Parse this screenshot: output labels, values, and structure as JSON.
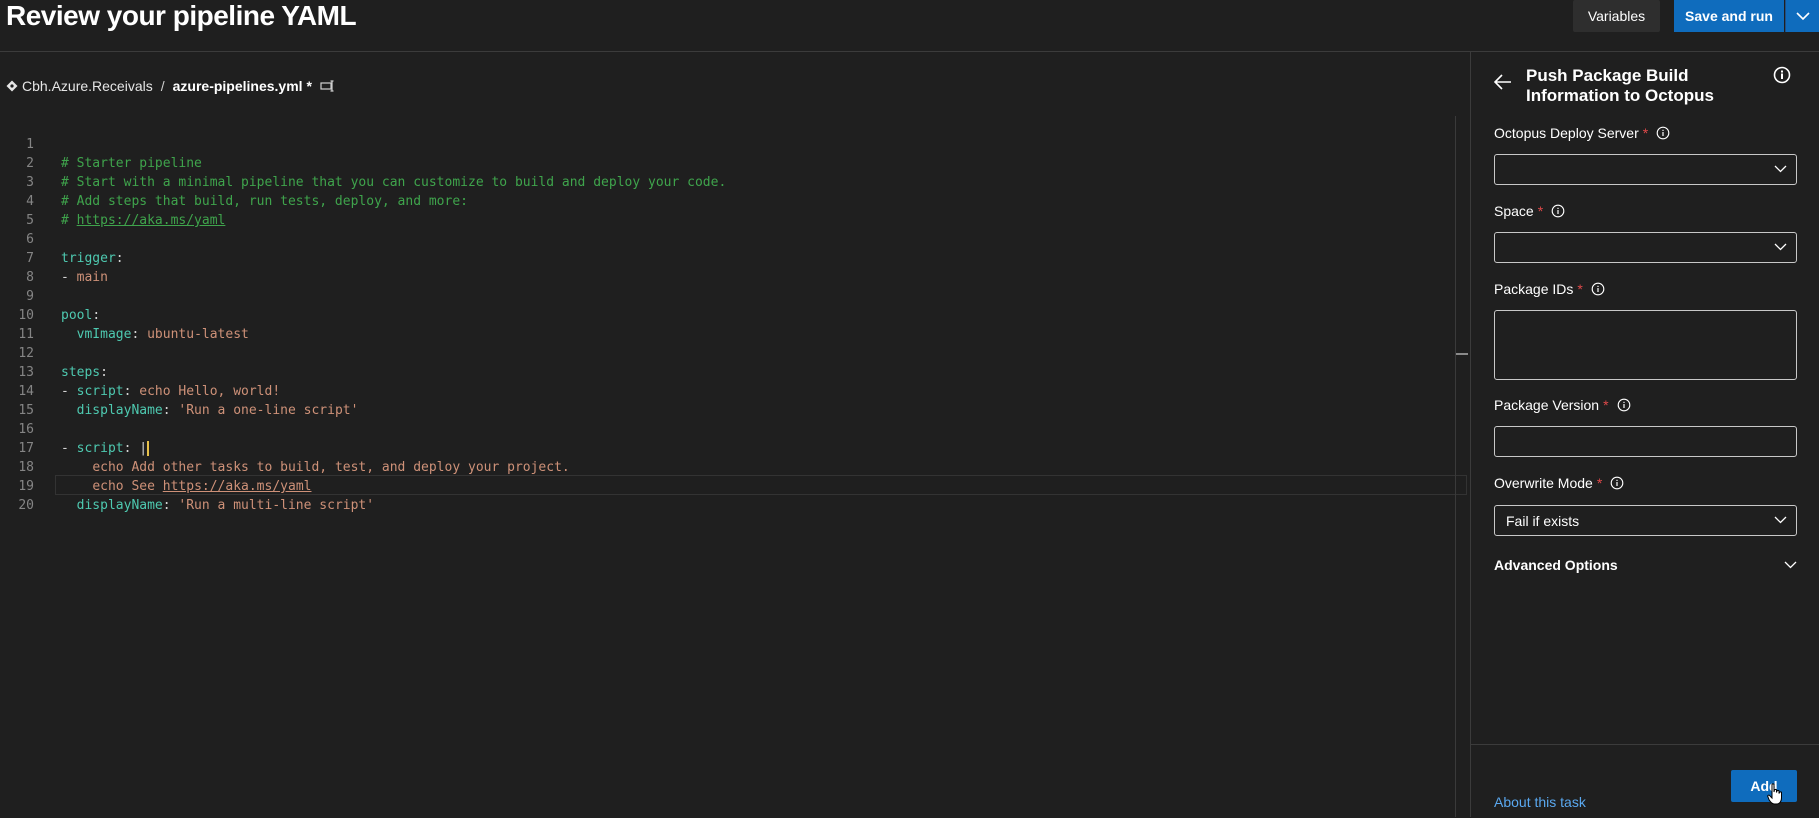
{
  "header": {
    "title": "Review your pipeline YAML",
    "variables_label": "Variables",
    "save_run_label": "Save and run"
  },
  "breadcrumb": {
    "repo": "Cbh.Azure.Receivals",
    "separator": "/",
    "file": "azure-pipelines.yml *"
  },
  "editor": {
    "lines": [
      {
        "n": "1",
        "text": "# Starter pipeline"
      },
      {
        "n": "2",
        "text": "# Start with a minimal pipeline that you can customize to build and deploy your code."
      },
      {
        "n": "3",
        "text": "# Add steps that build, run tests, deploy, and more:"
      },
      {
        "n": "4",
        "text": "# https://aka.ms/yaml"
      },
      {
        "n": "5",
        "text": ""
      },
      {
        "n": "6",
        "text": "trigger:"
      },
      {
        "n": "7",
        "text": "- main"
      },
      {
        "n": "8",
        "text": ""
      },
      {
        "n": "9",
        "text": "pool:"
      },
      {
        "n": "10",
        "text": "  vmImage: ubuntu-latest"
      },
      {
        "n": "11",
        "text": ""
      },
      {
        "n": "12",
        "text": "steps:"
      },
      {
        "n": "13",
        "text": "- script: echo Hello, world!"
      },
      {
        "n": "14",
        "text": "  displayName: 'Run a one-line script'"
      },
      {
        "n": "15",
        "text": ""
      },
      {
        "n": "16",
        "text": "- script: |"
      },
      {
        "n": "17",
        "text": "    echo Add other tasks to build, test, and deploy your project."
      },
      {
        "n": "18",
        "text": "    echo See https://aka.ms/yaml"
      },
      {
        "n": "19",
        "text": "  displayName: 'Run a multi-line script'"
      },
      {
        "n": "20",
        "text": ""
      }
    ],
    "tokens": {
      "l1": "# Starter pipeline",
      "l2": "# Start with a minimal pipeline that you can customize to build and deploy your code.",
      "l3": "# Add steps that build, run tests, deploy, and more:",
      "l4_hash": "# ",
      "l4_link": "https://aka.ms/yaml",
      "trigger_key": "trigger",
      "main_dash": "- ",
      "main_val": "main",
      "pool_key": "pool",
      "vmimage_key": "vmImage",
      "vmimage_val": "ubuntu-latest",
      "steps_key": "steps",
      "script_key": "script",
      "script1_val": "echo Hello, world!",
      "display_key": "displayName",
      "display1_val": "'Run a one-line script'",
      "pipe": "|",
      "l17_val": "echo Add other tasks to build, test, and deploy your project.",
      "l18_val": "echo See ",
      "l18_link": "https://aka.ms/yaml",
      "display2_val": "'Run a multi-line script'"
    }
  },
  "task_panel": {
    "title": "Push Package Build Information to Octopus",
    "fields": {
      "server_label": "Octopus Deploy Server",
      "server_value": "",
      "space_label": "Space",
      "space_value": "",
      "package_ids_label": "Package IDs",
      "package_ids_value": "",
      "package_version_label": "Package Version",
      "package_version_value": "",
      "overwrite_label": "Overwrite Mode",
      "overwrite_value": "Fail if exists"
    },
    "required_mark": "*",
    "advanced_label": "Advanced Options",
    "about_link": "About this task",
    "add_label": "Add"
  },
  "colors": {
    "accent": "#0f6cbd",
    "required": "#e0494a",
    "link": "#5aa8ef",
    "comment": "#3fa44c",
    "key": "#4ec9b0",
    "string": "#ce9178"
  }
}
